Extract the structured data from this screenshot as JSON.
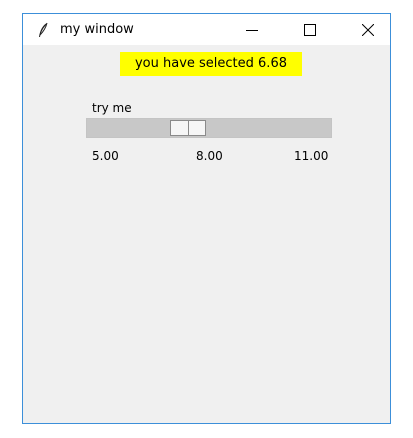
{
  "window": {
    "title": "my window",
    "accent": "#3c8fd9",
    "icons": [
      "feather-icon",
      "minimize-icon",
      "maximize-icon",
      "close-icon"
    ]
  },
  "label": {
    "text": "you have selected 6.68",
    "background": "#ffff00"
  },
  "scale": {
    "label": "try me",
    "min": 5,
    "max": 11,
    "value": 6.68,
    "ticks": [
      "5.00",
      "8.00",
      "11.00"
    ]
  }
}
